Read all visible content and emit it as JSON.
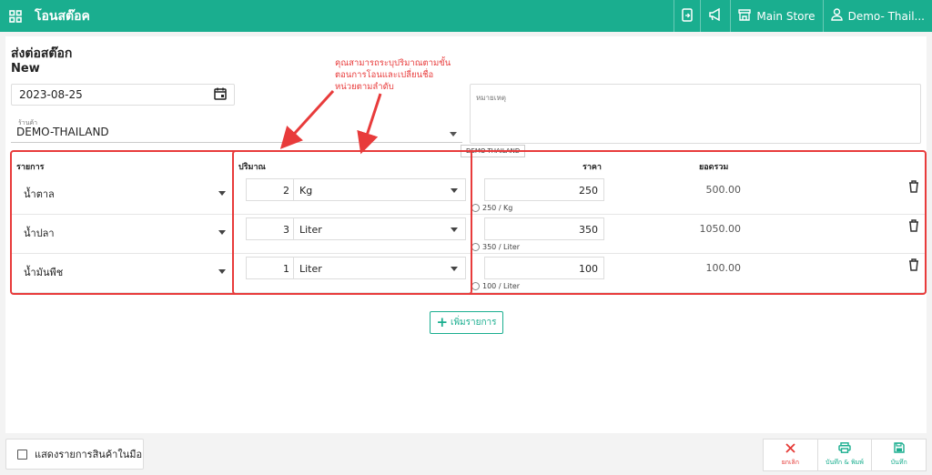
{
  "topbar": {
    "title": "โอนสต๊อค",
    "store_label": "Main Store",
    "user_label": "Demo- Thail..."
  },
  "form": {
    "heading": "ส่งต่อสต๊อก",
    "status": "New",
    "date": "2023-08-25",
    "store_field_label": "ร้านค้า",
    "store_value": "DEMO-THAILAND",
    "store_tooltip": "DEMO-THAILAND",
    "note_placeholder": "หมายเหตุ"
  },
  "table": {
    "headers": {
      "item": "รายการ",
      "qty": "ปริมาณ",
      "price": "ราคา",
      "total": "ยอดรวม"
    },
    "rows": [
      {
        "item": "น้ำตาล",
        "qty": "2",
        "unit": "Kg",
        "price": "250",
        "price_note": "250 / Kg",
        "total": "500.00"
      },
      {
        "item": "น้ำปลา",
        "qty": "3",
        "unit": "Liter",
        "price": "350",
        "price_note": "350 / Liter",
        "total": "1050.00"
      },
      {
        "item": "น้ำมันพืช",
        "qty": "1",
        "unit": "Liter",
        "price": "100",
        "price_note": "100 / Liter",
        "total": "100.00"
      }
    ],
    "add_label": "เพิ่มรายการ"
  },
  "annotation": {
    "text_lines": [
      "คุณสามารถระบุปริมาณตามขั้น",
      "ตอนการโอนและเปลี่ยนชื่อ",
      "หน่วยตามลำดับ"
    ]
  },
  "footer": {
    "show_items_label": "แสดงรายการสินค้าในมือ",
    "cancel_label": "ยกเลิก",
    "save_print_label": "บันทึก & พิมพ์",
    "save_label": "บันทึก"
  },
  "colors": {
    "brand": "#1aae8f",
    "annotation": "#e83b3b",
    "cancel": "#e53935"
  }
}
